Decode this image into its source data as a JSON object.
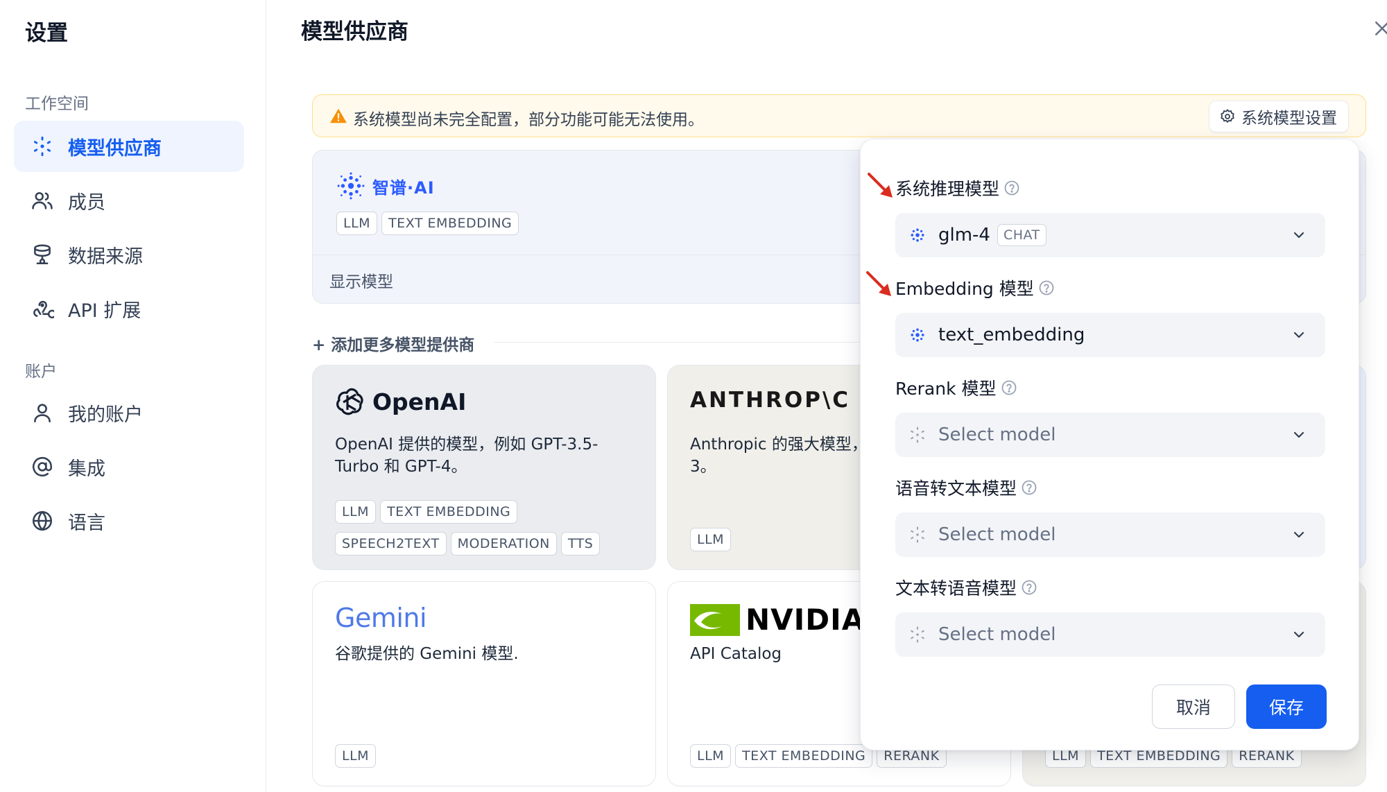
{
  "sidebar": {
    "title": "设置",
    "group_workspace": "工作空间",
    "group_account": "账户",
    "items": {
      "providers": "模型供应商",
      "members": "成员",
      "datasource": "数据来源",
      "api_ext": "API 扩展",
      "my_account": "我的账户",
      "integrations": "集成",
      "language": "语言"
    }
  },
  "main": {
    "title": "模型供应商",
    "warning_text": "系统模型尚未完全配置，部分功能可能无法使用。",
    "warning_button": "系统模型设置",
    "zhipu": {
      "name": "智谱·AI",
      "tags": [
        "LLM",
        "TEXT EMBEDDING"
      ],
      "footer": "显示模型"
    },
    "add_more": "+ 添加更多模型提供商",
    "cards": {
      "openai": {
        "name": "OpenAI",
        "desc": "OpenAI 提供的模型，例如 GPT-3.5-Turbo 和 GPT-4。",
        "tags_row1": [
          "LLM",
          "TEXT EMBEDDING"
        ],
        "tags_row2": [
          "SPEECH2TEXT",
          "MODERATION",
          "TTS"
        ]
      },
      "anthropic": {
        "name": "ANTHROP\\C",
        "desc": "Anthropic 的强大模型，",
        "desc2": "3。",
        "tags": [
          "LLM"
        ]
      },
      "gemini": {
        "name": "Gemini",
        "desc": "谷歌提供的 Gemini 模型.",
        "tags": [
          "LLM"
        ]
      },
      "nvidia": {
        "name": "NVIDIA",
        "desc": "API Catalog",
        "tags": [
          "LLM",
          "TEXT EMBEDDING",
          "RERANK"
        ]
      },
      "hidden": {
        "tags": [
          "LLM",
          "TEXT EMBEDDING",
          "RERANK"
        ]
      }
    }
  },
  "popover": {
    "reasoning": {
      "label": "系统推理模型",
      "value": "glm-4",
      "chip": "CHAT"
    },
    "embedding": {
      "label": "Embedding 模型",
      "value": "text_embedding"
    },
    "rerank": {
      "label": "Rerank 模型",
      "placeholder": "Select model"
    },
    "stt": {
      "label": "语音转文本模型",
      "placeholder": "Select model"
    },
    "tts": {
      "label": "文本转语音模型",
      "placeholder": "Select model"
    },
    "cancel": "取消",
    "save": "保存"
  },
  "colors": {
    "accent": "#155eef",
    "warning_bg": "#fffaeb",
    "arrow": "#d92d20"
  }
}
